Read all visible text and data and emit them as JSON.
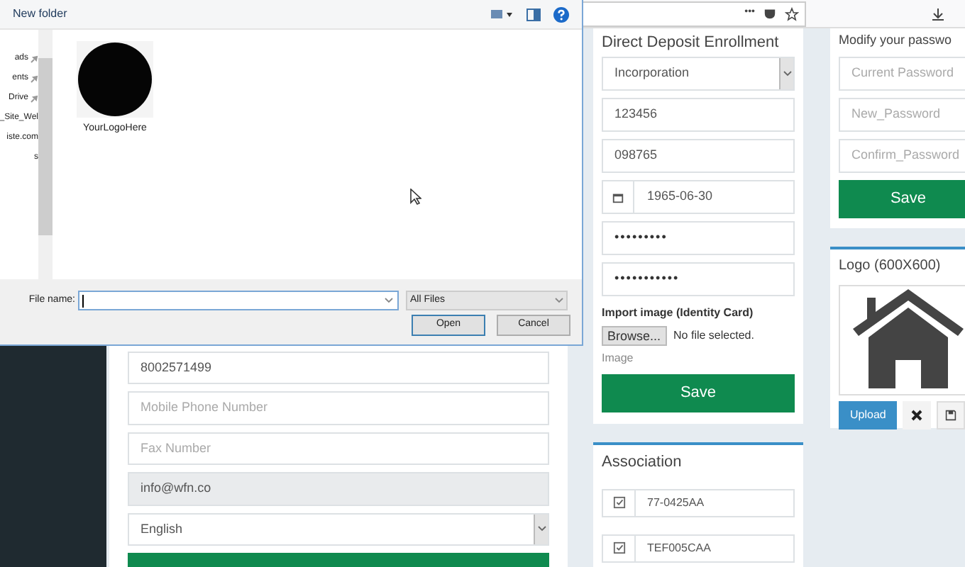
{
  "browser_toolbar": {
    "more": "•••"
  },
  "dialog": {
    "toolbar": {
      "new_folder": "New folder"
    },
    "nav_items": [
      {
        "label": "ads",
        "pinned": true
      },
      {
        "label": "ents",
        "pinned": true
      },
      {
        "label": "Drive",
        "pinned": true
      },
      {
        "label": "_Site_Wel",
        "pinned": false
      },
      {
        "label": "iste.com",
        "pinned": false
      },
      {
        "label": "s",
        "pinned": false
      }
    ],
    "files": [
      {
        "name": "YourLogoHere",
        "kind": "picture"
      }
    ],
    "file_name": {
      "label": "File name:"
    },
    "file_type": "All Files",
    "buttons": [
      {
        "label": "Open",
        "selected": true
      },
      {
        "label": "Cancel",
        "selected": false
      }
    ]
  },
  "profile_form": {
    "fields": [
      {
        "kind": "text",
        "value": "8002571499",
        "disabled": false
      },
      {
        "kind": "text",
        "placeholder": "Mobile Phone Number",
        "disabled": false
      },
      {
        "kind": "text",
        "placeholder": "Fax Number",
        "disabled": false
      },
      {
        "kind": "text",
        "value": "info@wfn.co",
        "disabled": true
      },
      {
        "kind": "select",
        "value": "English",
        "disabled": false
      }
    ]
  },
  "direct_deposit": {
    "title": "Direct Deposit Enrollment",
    "fields": [
      {
        "kind": "select",
        "value": "Incorporation"
      },
      {
        "kind": "text",
        "value": "123456"
      },
      {
        "kind": "text",
        "value": "098765"
      },
      {
        "kind": "date",
        "value": "1965-06-30"
      },
      {
        "kind": "password",
        "value": "•••••••••"
      },
      {
        "kind": "password",
        "value": "•••••••••••"
      }
    ],
    "import_label": "Import image (Identity Card)",
    "browse": "Browse...",
    "no_file": "No file selected.",
    "image_label": "Image",
    "save": "Save"
  },
  "association": {
    "title": "Association",
    "rows": [
      {
        "value": "77-0425AA",
        "checked": true
      },
      {
        "value": "TEF005CAA",
        "checked": true
      }
    ]
  },
  "password": {
    "title": "Modify your passwo",
    "fields": [
      {
        "placeholder": "Current Password"
      },
      {
        "placeholder": "New_Password"
      },
      {
        "placeholder": "Confirm_Password"
      }
    ],
    "save": "Save"
  },
  "logo": {
    "title": "Logo (600X600)",
    "upload": "Upload"
  }
}
